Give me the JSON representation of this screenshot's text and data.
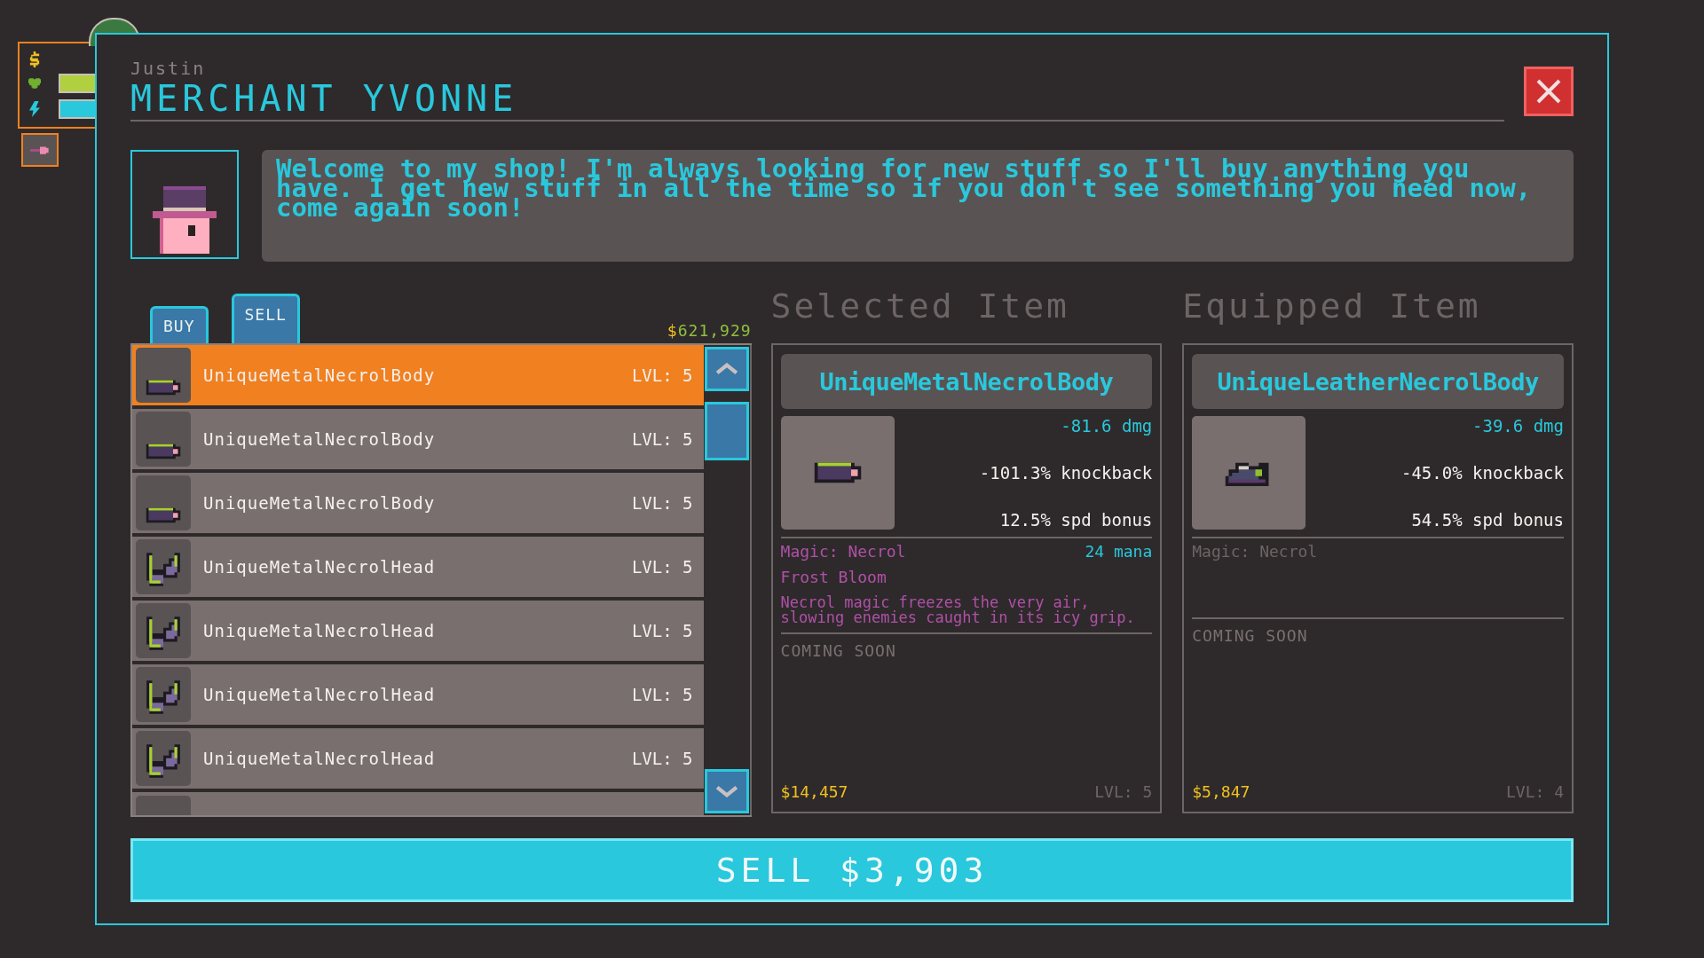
{
  "merchant": {
    "player": "Justin",
    "title": "MERCHANT YVONNE",
    "greeting": "Welcome to my shop! I'm always looking for new stuff so I'll buy anything you have. I get new stuff in all the time so if you don't see something you need now, come again soon!"
  },
  "tabs": [
    {
      "label": "BUY",
      "selected": false
    },
    {
      "label": "SELL",
      "selected": true
    }
  ],
  "money": {
    "symbol": "$",
    "amount": "621,929"
  },
  "items": [
    {
      "name": "UniqueMetalNecrolBody",
      "level": "LVL: 5",
      "kind": "body",
      "selected": true
    },
    {
      "name": "UniqueMetalNecrolBody",
      "level": "LVL: 5",
      "kind": "body",
      "selected": false
    },
    {
      "name": "UniqueMetalNecrolBody",
      "level": "LVL: 5",
      "kind": "body",
      "selected": false
    },
    {
      "name": "UniqueMetalNecrolHead",
      "level": "LVL: 5",
      "kind": "head",
      "selected": false
    },
    {
      "name": "UniqueMetalNecrolHead",
      "level": "LVL: 5",
      "kind": "head",
      "selected": false
    },
    {
      "name": "UniqueMetalNecrolHead",
      "level": "LVL: 5",
      "kind": "head",
      "selected": false
    },
    {
      "name": "UniqueMetalNecrolHead",
      "level": "LVL: 5",
      "kind": "head",
      "selected": false
    }
  ],
  "panels": [
    {
      "heading": "Selected Item",
      "name": "UniqueMetalNecrolBody",
      "kind": "body",
      "damage": "-81.6 dmg",
      "knockback": "-101.3% knockback",
      "speed": "12.5% spd bonus",
      "magic": "Magic: Necrol",
      "magic_active": true,
      "mana": "24 mana",
      "spell": "Frost Bloom",
      "description": "Necrol magic freezes the very air, slowing enemies caught in its icy grip.",
      "coming_soon": "COMING SOON",
      "price": "$14,457",
      "level": "LVL: 5"
    },
    {
      "heading": "Equipped Item",
      "name": "UniqueLeatherNecrolBody",
      "kind": "boot",
      "damage": "-39.6 dmg",
      "knockback": "-45.0% knockback",
      "speed": "54.5% spd bonus",
      "magic": "Magic: Necrol",
      "magic_active": false,
      "coming_soon": "COMING SOON",
      "price": "$5,847",
      "level": "LVL: 4"
    }
  ],
  "sell_button": "SELL $3,903"
}
